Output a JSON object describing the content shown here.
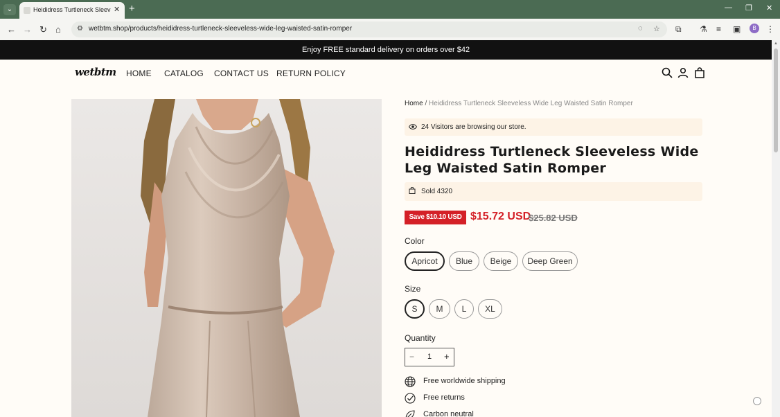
{
  "browser": {
    "tab_title": "Heididress Turtleneck Sleeveless",
    "tab_close": "✕",
    "new_tab": "+",
    "url": "wetbtm.shop/products/heididress-turtleneck-sleeveless-wide-leg-waisted-satin-romper",
    "profile_initial": "B",
    "window_controls": [
      "—",
      "❐",
      "✕"
    ]
  },
  "announcement": "Enjoy FREE standard delivery on orders over $42",
  "header": {
    "logo": "wetbtm",
    "nav": [
      "HOME",
      "CATALOG",
      "CONTACT US",
      "RETURN POLICY"
    ]
  },
  "product": {
    "breadcrumb_home": "Home",
    "breadcrumb_sep": " / ",
    "breadcrumb_current": "Heididress Turtleneck Sleeveless Wide Leg Waisted Satin Romper",
    "visitors": "24 Visitors are browsing our store.",
    "title": "Heididress Turtleneck Sleeveless Wide Leg Waisted Satin Romper",
    "sold": "Sold 4320",
    "save_badge": "Save $10.10 USD",
    "price": "$15.72 USD",
    "compare_price": "$25.82 USD",
    "color_label": "Color",
    "colors": [
      "Apricot",
      "Blue",
      "Beige",
      "Deep Green"
    ],
    "selected_color": "Apricot",
    "size_label": "Size",
    "sizes": [
      "S",
      "M",
      "L",
      "XL"
    ],
    "selected_size": "S",
    "quantity_label": "Quantity",
    "quantity_value": "1",
    "qty_minus": "−",
    "qty_plus": "+",
    "features": [
      "Free worldwide shipping",
      "Free returns",
      "Carbon neutral"
    ]
  },
  "colors": {
    "accent_red": "#d42027",
    "tabbar_green": "#4b6b53",
    "highlight_bg": "#fdf3e6",
    "page_bg": "#fffcf7"
  }
}
